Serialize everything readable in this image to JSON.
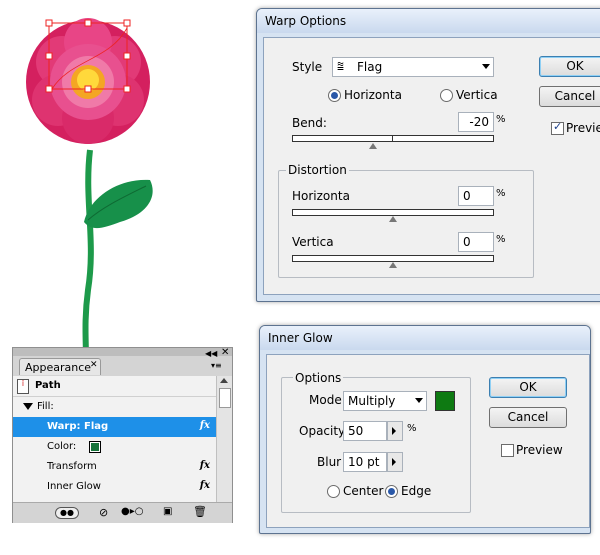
{
  "warp": {
    "title": "Warp Options",
    "style_label": "Style",
    "style_value": "Flag",
    "orient_horizontal": "Horizonta",
    "orient_vertical": "Vertica",
    "orient_selected": "horizontal",
    "bend_label": "Bend:",
    "bend_value": "-20",
    "percent": "%",
    "distortion_label": "Distortion",
    "dist_horizontal_label": "Horizonta",
    "dist_horizontal_value": "0",
    "dist_vertical_label": "Vertica",
    "dist_vertical_value": "0",
    "ok": "OK",
    "cancel": "Cancel",
    "preview": "Preview",
    "preview_checked": true
  },
  "glow": {
    "title": "Inner Glow",
    "options_label": "Options",
    "mode_label": "Mode",
    "mode_value": "Multiply",
    "glow_color": "#0e7a12",
    "opacity_label": "Opacity",
    "opacity_value": "50",
    "percent": "%",
    "blur_label": "Blur",
    "blur_value": "10 pt",
    "center_label": "Center",
    "edge_label": "Edge",
    "position_selected": "edge",
    "ok": "OK",
    "cancel": "Cancel",
    "preview": "Preview",
    "preview_checked": false
  },
  "appearance": {
    "tab_title": "Appearance",
    "path_label": "Path",
    "fill_label": "Fill:",
    "items": [
      {
        "label": "Warp: Flag",
        "fx": "fx",
        "selected": true
      },
      {
        "label": "Color:",
        "swatch": "#16733a"
      },
      {
        "label": "Transform",
        "fx": "fx"
      },
      {
        "label": "Inner Glow",
        "fx": "fx"
      }
    ]
  },
  "colors": {
    "flower_petal": "#d4205f",
    "flower_center": "#f7c12a",
    "stem": "#1d9a4a",
    "leaf": "#17904a",
    "selection": "#ee2222",
    "panel_selected": "#1e90e8"
  }
}
